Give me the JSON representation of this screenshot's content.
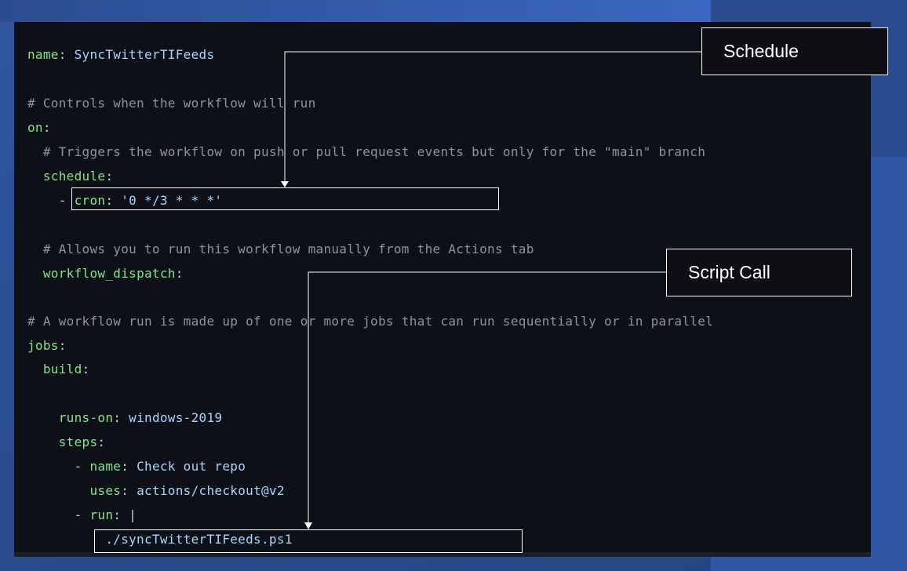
{
  "code_lines": [
    {
      "indent": "",
      "key": "name",
      "sep": ": ",
      "value": "SyncTwitterTIFeeds"
    },
    {
      "comment": "# Controls when the workflow will run"
    },
    {
      "indent": "",
      "key": "on",
      "sep": ":"
    },
    {
      "comment": "  # Triggers the workflow on push or pull request events but only for the \"main\" branch"
    },
    {
      "indent": "  ",
      "key": "schedule",
      "sep": ":"
    },
    {
      "indent": "    - ",
      "key": "cron",
      "sep": ": ",
      "value": "'0 */3 * * *'"
    },
    {
      "comment": "  # Allows you to run this workflow manually from the Actions tab"
    },
    {
      "indent": "  ",
      "key": "workflow_dispatch",
      "sep": ":"
    },
    {
      "comment": "# A workflow run is made up of one or more jobs that can run sequentially or in parallel"
    },
    {
      "indent": "",
      "key": "jobs",
      "sep": ":"
    },
    {
      "indent": "  ",
      "key": "build",
      "sep": ":"
    },
    {
      "indent": "    ",
      "key": "runs-on",
      "sep": ": ",
      "value": "windows-2019"
    },
    {
      "indent": "    ",
      "key": "steps",
      "sep": ":"
    },
    {
      "indent": "      - ",
      "key": "name",
      "sep": ": ",
      "value": "Check out repo"
    },
    {
      "indent": "        ",
      "key": "uses",
      "sep": ": ",
      "value": "actions/checkout@v2"
    },
    {
      "indent": "      - ",
      "key": "run",
      "sep": ": ",
      "value": "|"
    },
    {
      "indent": "          ",
      "value": "./syncTwitterTIFeeds.ps1"
    }
  ],
  "callouts": {
    "schedule": "Schedule",
    "script_call": "Script Call"
  }
}
